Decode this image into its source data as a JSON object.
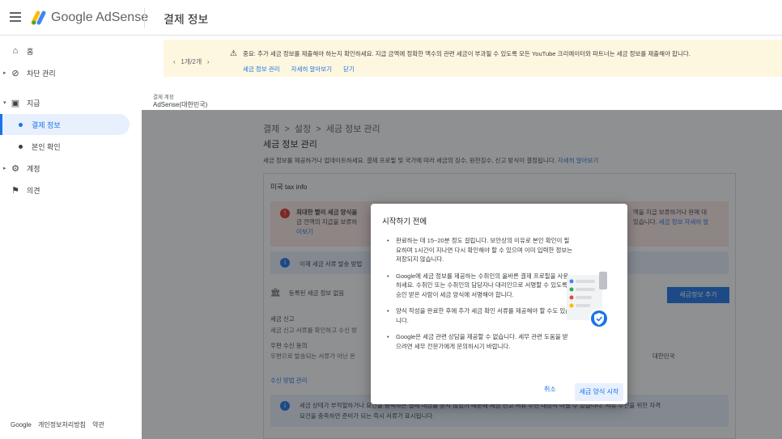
{
  "app": {
    "name": "Google AdSense",
    "page_title": "결제 정보"
  },
  "sidebar": {
    "items": [
      {
        "label": "홈",
        "icon": "home-icon"
      },
      {
        "label": "차단 관리",
        "icon": "block-icon"
      },
      {
        "label": "지급",
        "icon": "payments-icon"
      },
      {
        "label": "결제 정보"
      },
      {
        "label": "본인 확인"
      },
      {
        "label": "계정",
        "icon": "gear-icon"
      },
      {
        "label": "의견",
        "icon": "feedback-icon"
      }
    ],
    "footer": {
      "brand": "Google",
      "privacy": "개인정보처리방침",
      "terms": "약관"
    }
  },
  "banner": {
    "pager": "1개/2개",
    "message": "중요: 추가 세금 정보를 제출해야 하는지 확인하세요. 지급 금액에 정확한 액수의 관련 세금이 부과될 수 있도록 모든 YouTube 크리에이터와 파트너는 세금 정보를 제출해야 합니다.",
    "link_manage": "세금 정보 관리",
    "link_learn": "자세히 알아보기",
    "link_close": "닫기"
  },
  "account": {
    "label": "결제 계정",
    "value": "AdSense(대한민국)"
  },
  "content": {
    "breadcrumb": "결제  >  설정  >  세금 정보 관리",
    "title": "세금 정보 관리",
    "desc": "세금 정보를 제공하거나 업데이트하세요. 결제 프로필 및 국가에 따라 세금의 징수, 원천징수, 신고 방식이 결정됩니다.",
    "desc_link": "자세히 알아보기",
    "card_title": "미국 tax info",
    "err_line1": "최대한 빨리 세금 양식을",
    "err_line2": "금 전액의 지급을 보류하",
    "err_line3": "아보기",
    "err_right1": "액을 지급 보류하거나 판매 대",
    "err_right2_text": "있습니다. ",
    "err_right2_link": "세금 정보 자세히 알",
    "info_text": "이제 세금 서류 발송 방법",
    "bank_label": "등록된 세금 정보 없음",
    "add_button": "세금정보 추가",
    "report_label": "세금 신고",
    "report_desc": "세금 신고 서류를 확인하고 수신 방",
    "mail_label": "우편 수신 동의",
    "mail_desc": "우편으로 발송되는 서류가 아닌 온",
    "country": "대한민국",
    "manage_link": "수신 방법 관리",
    "info2_line1": "세금 상태가 부적절하거나 요건을 충족하는 결제 대금을 받지 않았기 때문에 세금 신고 서류 수신 대상이 아닐 수 있습니다. 서류 수신을 위한 자격",
    "info2_line2": "요건을 충족하면 준비가 되는 즉시 서류가 표시됩니다."
  },
  "dialog": {
    "title": "시작하기 전에",
    "items": [
      "완료하는 데 15~20분 정도 걸립니다. 보안상의 이유로 본인 확인이 필요하며 1시간이 지나면 다시 확인해야 할 수 있으며 이미 입력한 정보는 저장되지 않습니다.",
      "Google에 세금 정보를 제공하는 수취인의 올바른 결제 프로필을 사용하세요. 수취인 또는 수취인의 담당자나 대리인으로 서명할 수 있도록 승인 받은 사람이 세금 양식에 서명해야 합니다.",
      "양식 작성을 완료한 후에 추가 세금 확인 서류를 제공해야 할 수도 있습니다.",
      "Google은 세금 관련 상담을 제공할 수 없습니다. 세무 관련 도움을 받으려면 세무 전문가에게 문의하시기 바랍니다."
    ],
    "cancel": "취소",
    "start": "세금 양식 시작"
  },
  "colors": {
    "accent": "#1a73e8",
    "banner_bg": "#fef7e0",
    "error_bg": "#fce8e6",
    "info_bg": "#e8f0fe"
  }
}
